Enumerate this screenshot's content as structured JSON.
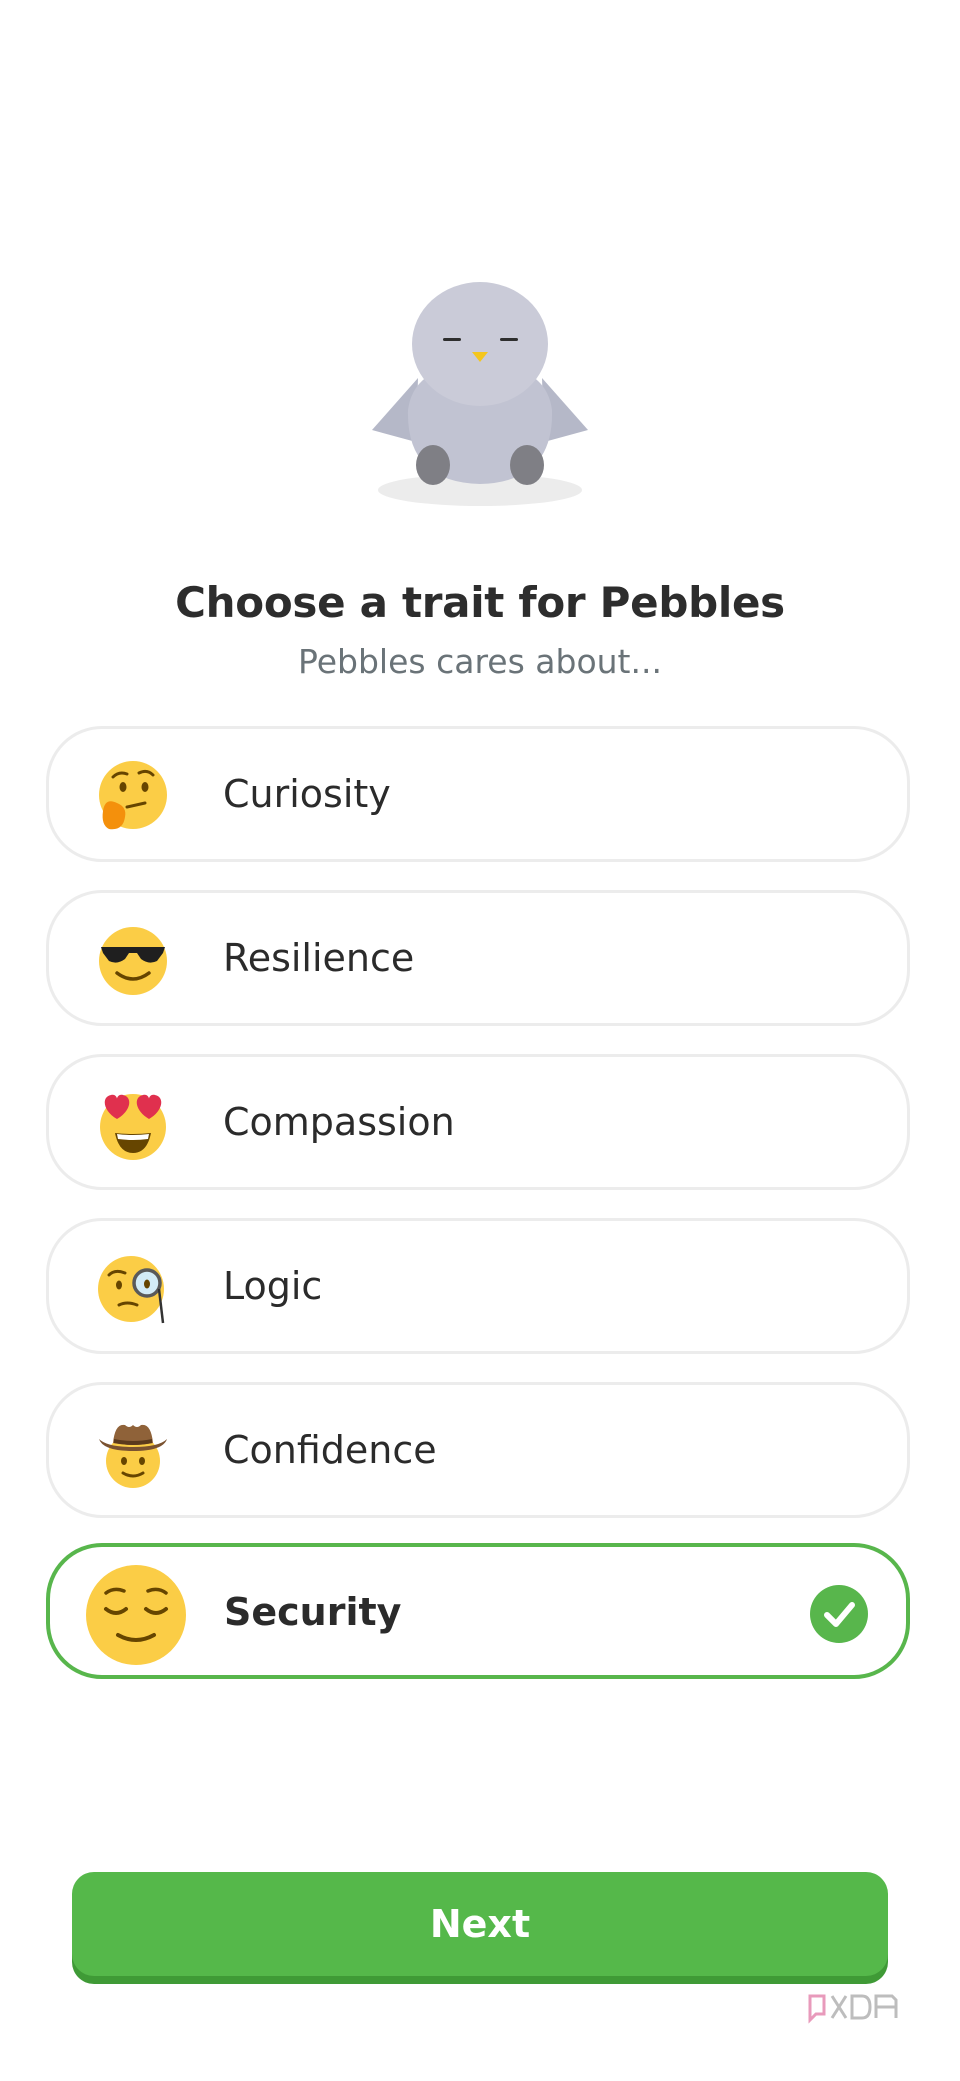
{
  "header": {
    "title": "Choose a trait for Pebbles",
    "subtitle": "Pebbles cares about..."
  },
  "mascot": {
    "icon": "pebbles-bird-icon"
  },
  "traits": [
    {
      "label": "Curiosity",
      "icon": "thinking-face-icon",
      "selected": false
    },
    {
      "label": "Resilience",
      "icon": "sunglasses-face-icon",
      "selected": false
    },
    {
      "label": "Compassion",
      "icon": "heart-eyes-face-icon",
      "selected": false
    },
    {
      "label": "Logic",
      "icon": "monocle-face-icon",
      "selected": false
    },
    {
      "label": "Confidence",
      "icon": "cowboy-face-icon",
      "selected": false
    },
    {
      "label": "Security",
      "icon": "relieved-face-icon",
      "selected": true
    }
  ],
  "next_button": {
    "label": "Next"
  },
  "colors": {
    "accent": "#58b64c",
    "button": "#55b84a",
    "border": "#ececec",
    "emoji": "#fbcd46",
    "subtitle": "#6a7378"
  },
  "watermark": {
    "icon": "xda-logo-icon"
  }
}
